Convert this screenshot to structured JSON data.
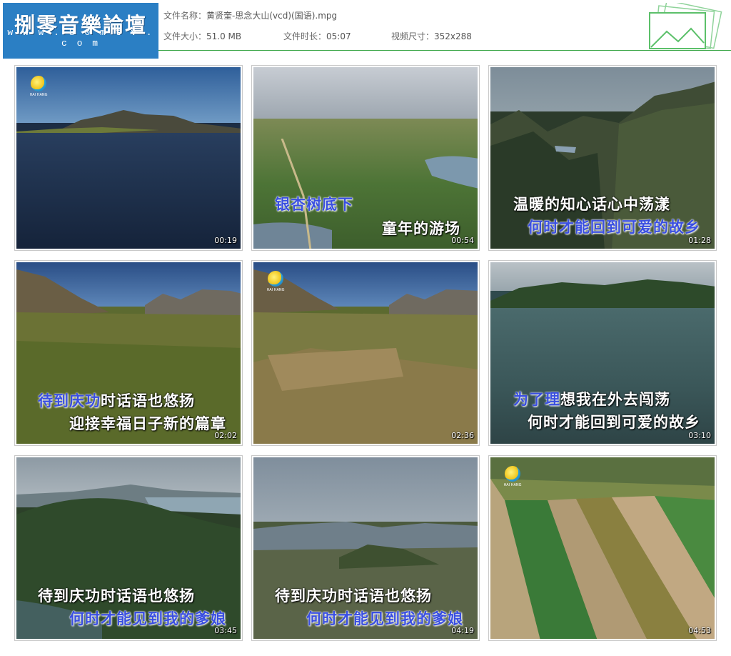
{
  "header": {
    "logo_title": "捌零音樂論壇",
    "logo_url": "w w w . 8 0 m t v . c o m",
    "file_name_label": "文件名称：",
    "file_name": "黄贤奎-思念大山(vcd)(国语).mpg",
    "file_size_label": "文件大小：",
    "file_size": "51.0 MB",
    "duration_label": "文件时长：",
    "duration": "05:07",
    "dimensions_label": "视频尺寸：",
    "dimensions": "352x288",
    "accent_color": "#3aa647",
    "logo_color": "#2b7fc4"
  },
  "thumbnails": [
    {
      "time": "00:19",
      "lyrics": [],
      "logo": true,
      "scene": "lake-mountain"
    },
    {
      "time": "00:54",
      "lyrics": [
        "银杏树底下",
        "童年的游场"
      ],
      "logo": false,
      "scene": "aerial-fields-river"
    },
    {
      "time": "01:28",
      "lyrics": [
        "温暖的知心话心中荡漾",
        "何时才能回到可爱的故乡"
      ],
      "logo": false,
      "scene": "mountain-valley"
    },
    {
      "time": "02:02",
      "lyrics": [
        "待到庆功时话语也悠扬",
        "迎接幸福日子新的篇章"
      ],
      "logo": false,
      "scene": "reed-field-mountains"
    },
    {
      "time": "02:36",
      "lyrics": [],
      "logo": true,
      "scene": "reed-field-mountains"
    },
    {
      "time": "03:10",
      "lyrics": [
        "为了理想我在外去闯荡",
        "何时才能回到可爱的故乡"
      ],
      "logo": false,
      "scene": "lake-hills"
    },
    {
      "time": "03:45",
      "lyrics": [
        "待到庆功时话语也悠扬",
        "何时才能见到我的爹娘"
      ],
      "logo": false,
      "scene": "forest-hill-lake"
    },
    {
      "time": "04:19",
      "lyrics": [
        "待到庆功时话语也悠扬",
        "何时才能见到我的爹娘"
      ],
      "logo": false,
      "scene": "hazy-valley"
    },
    {
      "time": "04:53",
      "lyrics": [],
      "logo": true,
      "scene": "crop-rows"
    }
  ]
}
